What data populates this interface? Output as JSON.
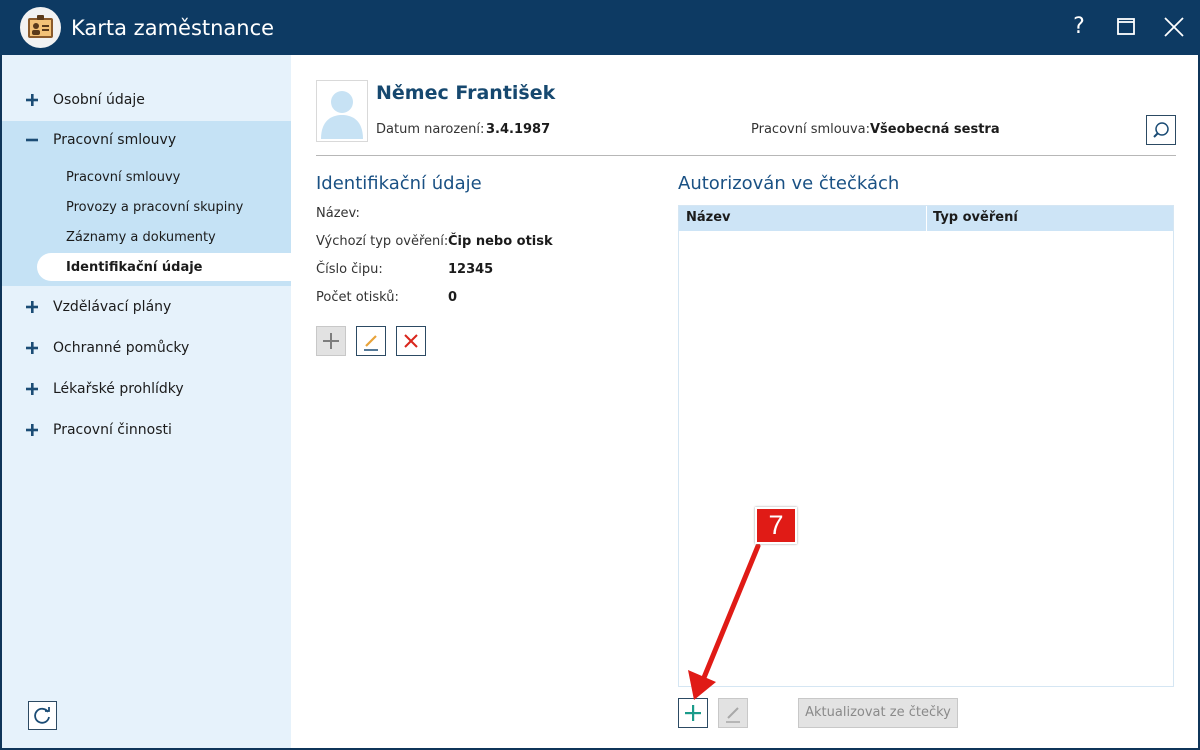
{
  "window": {
    "title": "Karta zaměstnance",
    "help_label": "?"
  },
  "sidebar": {
    "items": [
      {
        "label": "Osobní údaje",
        "icon": "plus-icon"
      },
      {
        "label": "Pracovní smlouvy",
        "icon": "minus-icon"
      },
      {
        "label": "Vzdělávací plány",
        "icon": "plus-icon"
      },
      {
        "label": "Ochranné pomůcky",
        "icon": "plus-icon"
      },
      {
        "label": "Lékařské prohlídky",
        "icon": "plus-icon"
      },
      {
        "label": "Pracovní činnosti",
        "icon": "plus-icon"
      }
    ],
    "subitems": [
      {
        "label": "Pracovní smlouvy"
      },
      {
        "label": "Provozy a pracovní skupiny"
      },
      {
        "label": "Záznamy a dokumenty"
      },
      {
        "label": "Identifikační údaje",
        "active": true
      }
    ]
  },
  "header": {
    "name": "Němec František",
    "birth_label": "Datum narození:",
    "birth_value": "3.4.1987",
    "contract_label": "Pracovní smlouva:",
    "contract_value": "Všeobecná sestra"
  },
  "identification": {
    "title": "Identifikační údaje",
    "fields": [
      {
        "label": "Název:",
        "value": ""
      },
      {
        "label": "Výchozí typ ověření:",
        "value": "Čip nebo otisk"
      },
      {
        "label": "Číslo čipu:",
        "value": "12345"
      },
      {
        "label": "Počet otisků:",
        "value": "0"
      }
    ]
  },
  "readers": {
    "title": "Autorizován ve čtečkách",
    "columns": [
      "Název",
      "Typ ověření"
    ],
    "rows": [],
    "update_label": "Aktualizovat ze čtečky"
  },
  "callout": {
    "step": "7"
  },
  "colors": {
    "titlebar": "#0d3a63",
    "sidebar": "#e6f2fb",
    "accent": "#1a5184",
    "callout": "#e01b16"
  }
}
